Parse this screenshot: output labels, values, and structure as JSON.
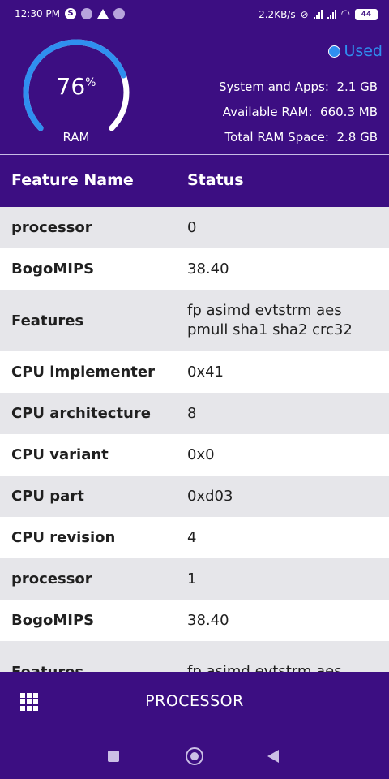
{
  "status_bar": {
    "time": "12:30 PM",
    "net_speed": "2.2KB/s",
    "battery": "44"
  },
  "ram": {
    "percent": "76",
    "percent_symbol": "%",
    "label": "RAM",
    "fill_fraction": 0.76,
    "legend_label": "Used",
    "system_and_apps_label": "System and Apps:",
    "system_and_apps_value": "2.1 GB",
    "available_label": "Available RAM:",
    "available_value": "660.3 MB",
    "total_label": "Total RAM Space:",
    "total_value": "2.8 GB"
  },
  "table": {
    "col_feature": "Feature Name",
    "col_status": "Status",
    "rows": [
      {
        "name": "processor",
        "value": "0"
      },
      {
        "name": "BogoMIPS",
        "value": "38.40"
      },
      {
        "name": "Features",
        "value": "fp asimd evtstrm aes pmull sha1 sha2 crc32"
      },
      {
        "name": "CPU implementer",
        "value": "0x41"
      },
      {
        "name": "CPU architecture",
        "value": "8"
      },
      {
        "name": "CPU variant",
        "value": "0x0"
      },
      {
        "name": "CPU part",
        "value": "0xd03"
      },
      {
        "name": "CPU revision",
        "value": "4"
      },
      {
        "name": "processor",
        "value": "1"
      },
      {
        "name": "BogoMIPS",
        "value": "38.40"
      },
      {
        "name": "Features",
        "value": "fp asimd evtstrm aes"
      }
    ]
  },
  "bottom_bar": {
    "title": "PROCESSOR",
    "menu_icon": "grid-menu-icon"
  },
  "colors": {
    "primary": "#3c0e82",
    "gauge_used": "#2f8ff0",
    "row_alt": "#e6e6ea"
  }
}
